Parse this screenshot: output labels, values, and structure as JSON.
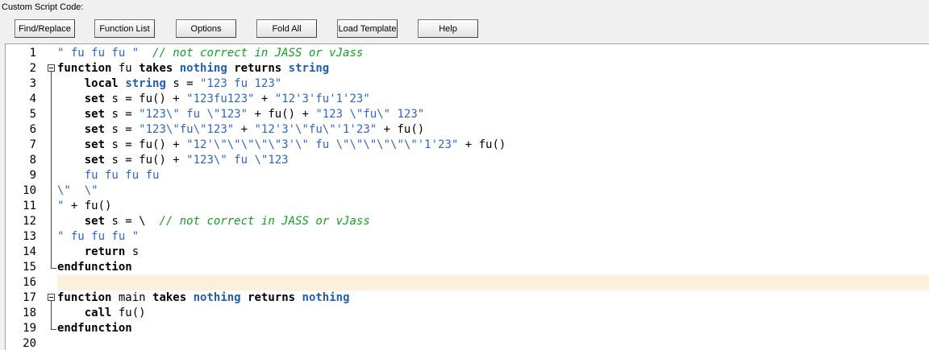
{
  "title": "Custom Script Code:",
  "buttons": [
    {
      "label": "Find/Replace"
    },
    {
      "label": "Function List"
    },
    {
      "label": "Options"
    },
    {
      "label": "Fold All"
    },
    {
      "label": "Load Template"
    },
    {
      "label": "Help"
    }
  ],
  "editor": {
    "current_line": 16,
    "lines": [
      {
        "n": "1",
        "t": [
          [
            "str",
            "\" fu fu fu \"  "
          ],
          [
            "cmt",
            "// not correct in JASS or vJass"
          ]
        ]
      },
      {
        "n": "2",
        "fold": "start",
        "t": [
          [
            "kw",
            "function"
          ],
          [
            "plain",
            " fu "
          ],
          [
            "kw",
            "takes"
          ],
          [
            "plain",
            " "
          ],
          [
            "type",
            "nothing"
          ],
          [
            "plain",
            " "
          ],
          [
            "kw",
            "returns"
          ],
          [
            "plain",
            " "
          ],
          [
            "type",
            "string"
          ]
        ]
      },
      {
        "n": "3",
        "t": [
          [
            "plain",
            "    "
          ],
          [
            "kw",
            "local"
          ],
          [
            "plain",
            " "
          ],
          [
            "type",
            "string"
          ],
          [
            "plain",
            " s = "
          ],
          [
            "str",
            "\"123 fu 123\""
          ]
        ]
      },
      {
        "n": "4",
        "t": [
          [
            "plain",
            "    "
          ],
          [
            "kw",
            "set"
          ],
          [
            "plain",
            " s = fu() + "
          ],
          [
            "str",
            "\"123fu123\""
          ],
          [
            "plain",
            " + "
          ],
          [
            "str",
            "\"12'3'fu'1'23\""
          ]
        ]
      },
      {
        "n": "5",
        "t": [
          [
            "plain",
            "    "
          ],
          [
            "kw",
            "set"
          ],
          [
            "plain",
            " s = "
          ],
          [
            "str",
            "\"123\\\" fu \\\"123\""
          ],
          [
            "plain",
            " + fu() + "
          ],
          [
            "str",
            "\"123 \\\"fu\\\" 123\""
          ]
        ]
      },
      {
        "n": "6",
        "t": [
          [
            "plain",
            "    "
          ],
          [
            "kw",
            "set"
          ],
          [
            "plain",
            " s = "
          ],
          [
            "str",
            "\"123\\\"fu\\\"123\""
          ],
          [
            "plain",
            " + "
          ],
          [
            "str",
            "\"12'3'\\\"fu\\\"'1'23\""
          ],
          [
            "plain",
            " + fu()"
          ]
        ]
      },
      {
        "n": "7",
        "t": [
          [
            "plain",
            "    "
          ],
          [
            "kw",
            "set"
          ],
          [
            "plain",
            " s = fu() + "
          ],
          [
            "str",
            "\"12'\\\"\\\"\\\"\\\"\\\"3'\\\" fu \\\"\\\"\\\"\\\"\\\"\\\"'1'23\""
          ],
          [
            "plain",
            " + fu()"
          ]
        ]
      },
      {
        "n": "8",
        "t": [
          [
            "plain",
            "    "
          ],
          [
            "kw",
            "set"
          ],
          [
            "plain",
            " s = fu() + "
          ],
          [
            "str",
            "\"123\\\" fu \\\"123"
          ]
        ]
      },
      {
        "n": "9",
        "t": [
          [
            "str",
            "    fu fu fu fu"
          ]
        ]
      },
      {
        "n": "10",
        "t": [
          [
            "str",
            "\\\"  \\\""
          ]
        ]
      },
      {
        "n": "11",
        "t": [
          [
            "str",
            "\""
          ],
          [
            "plain",
            " + fu()"
          ]
        ]
      },
      {
        "n": "12",
        "t": [
          [
            "plain",
            "    "
          ],
          [
            "kw",
            "set"
          ],
          [
            "plain",
            " s = \\  "
          ],
          [
            "cmt",
            "// not correct in JASS or vJass"
          ]
        ]
      },
      {
        "n": "13",
        "t": [
          [
            "str",
            "\" fu fu fu \""
          ]
        ]
      },
      {
        "n": "14",
        "t": [
          [
            "plain",
            "    "
          ],
          [
            "kw",
            "return"
          ],
          [
            "plain",
            " s"
          ]
        ]
      },
      {
        "n": "15",
        "fold": "end",
        "t": [
          [
            "kw",
            "endfunction"
          ]
        ]
      },
      {
        "n": "16",
        "t": []
      },
      {
        "n": "17",
        "fold": "start",
        "t": [
          [
            "kw",
            "function"
          ],
          [
            "plain",
            " main "
          ],
          [
            "kw",
            "takes"
          ],
          [
            "plain",
            " "
          ],
          [
            "type",
            "nothing"
          ],
          [
            "plain",
            " "
          ],
          [
            "kw",
            "returns"
          ],
          [
            "plain",
            " "
          ],
          [
            "type",
            "nothing"
          ]
        ]
      },
      {
        "n": "18",
        "t": [
          [
            "plain",
            "    "
          ],
          [
            "kw",
            "call"
          ],
          [
            "plain",
            " fu()"
          ]
        ]
      },
      {
        "n": "19",
        "fold": "end",
        "t": [
          [
            "kw",
            "endfunction"
          ]
        ]
      },
      {
        "n": "20",
        "t": []
      }
    ]
  }
}
